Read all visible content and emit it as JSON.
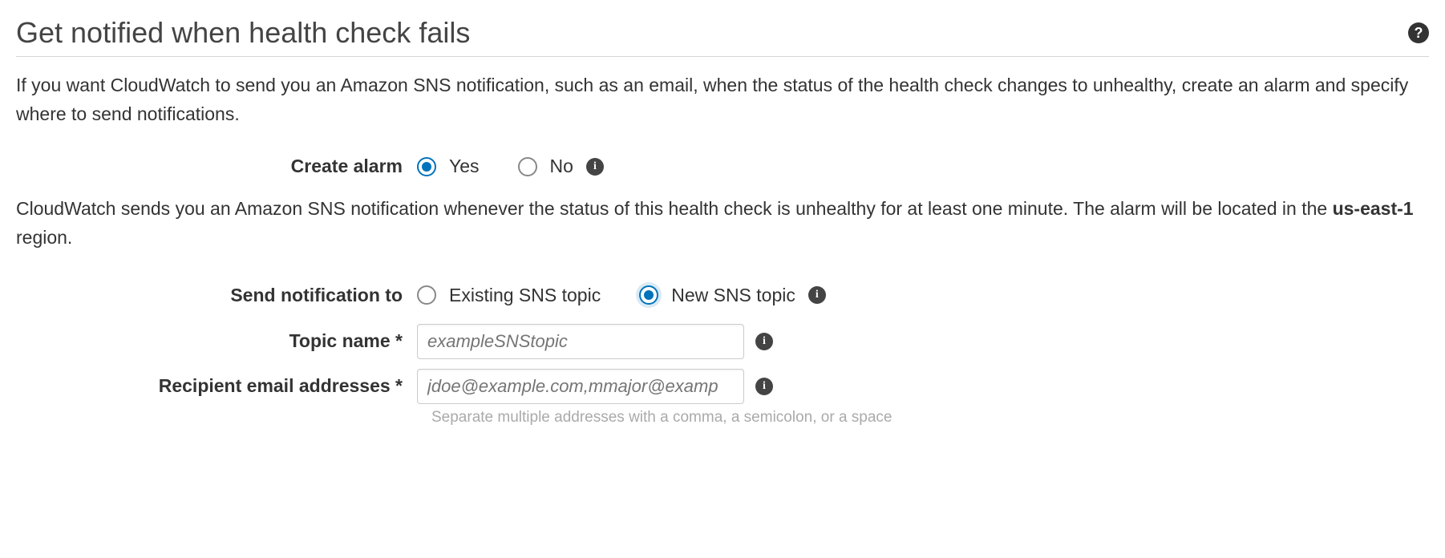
{
  "header": {
    "title": "Get notified when health check fails"
  },
  "description": "If you want CloudWatch to send you an Amazon SNS notification, such as an email, when the status of the health check changes to unhealthy, create an alarm and specify where to send notifications.",
  "create_alarm": {
    "label": "Create alarm",
    "yes_label": "Yes",
    "no_label": "No"
  },
  "alarm_note": {
    "prefix": "CloudWatch sends you an Amazon SNS notification whenever the status of this health check is unhealthy for at least one minute. The alarm will be located in the ",
    "region": "us-east-1",
    "suffix": " region."
  },
  "send_to": {
    "label": "Send notification to",
    "existing_label": "Existing SNS topic",
    "new_label": "New SNS topic"
  },
  "topic_name": {
    "label": "Topic name *",
    "placeholder": "exampleSNStopic"
  },
  "recipients": {
    "label": "Recipient email addresses *",
    "placeholder": "jdoe@example.com,mmajor@examp",
    "hint": "Separate multiple addresses with a comma, a semicolon, or a space"
  },
  "icons": {
    "help": "?",
    "info": "i"
  }
}
